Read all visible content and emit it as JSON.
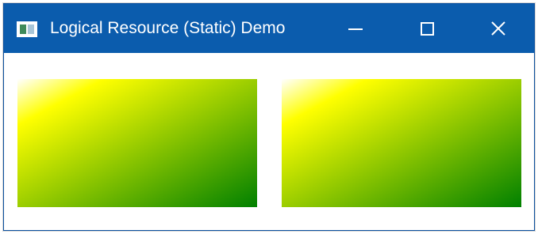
{
  "window": {
    "title": "Logical Resource (Static) Demo"
  },
  "caption_buttons": {
    "minimize": "minimize-icon",
    "maximize": "maximize-icon",
    "close": "close-icon"
  },
  "resource": {
    "type": "linear-gradient",
    "direction": "top-left to bottom-right",
    "stops": [
      "#ffffff",
      "#ffff00",
      "#008000"
    ],
    "offsets": [
      0,
      0.18,
      1
    ]
  },
  "content": {
    "rectangles": [
      "gradient-rectangle",
      "gradient-rectangle"
    ]
  }
}
